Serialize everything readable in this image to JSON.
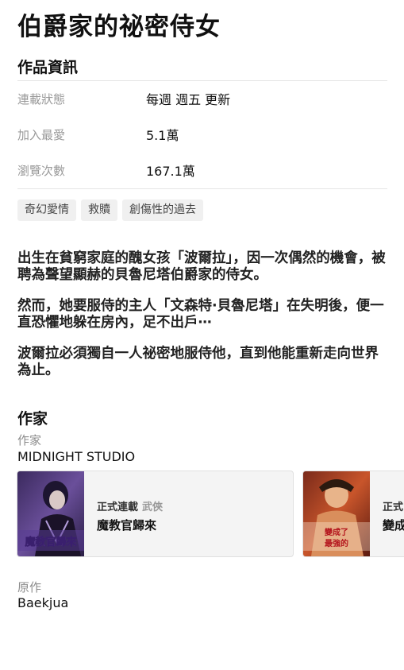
{
  "title": "伯爵家的祕密侍女",
  "info": {
    "section_title": "作品資訊",
    "rows": [
      {
        "label": "連載狀態",
        "value": "每週 週五 更新"
      },
      {
        "label": "加入最愛",
        "value": "5.1萬"
      },
      {
        "label": "瀏覽次數",
        "value": "167.1萬"
      }
    ],
    "tags": [
      "奇幻愛情",
      "救贖",
      "創傷性的過去"
    ]
  },
  "description": [
    "出生在貧窮家庭的醜女孩「波爾拉」，因一次偶然的機會，被聘為聲望顯赫的貝魯尼塔伯爵家的侍女。",
    "然而，她要服侍的主人「文森特·貝魯尼塔」在失明後，便一直恐懼地躲在房內，足不出戶⋯",
    "波爾拉必須獨自一人祕密地服侍他，直到他能重新走向世界為止。"
  ],
  "author_section": {
    "title": "作家",
    "author_label": "作家",
    "author_name": "MIDNIGHT STUDIO",
    "cards": [
      {
        "status": "正式連載",
        "genre": "武俠",
        "name": "魔教官歸來",
        "thumb_text": "魔教官歸來"
      },
      {
        "status": "正式",
        "genre": "",
        "name": "變成",
        "thumb_text": "變成了最強的"
      }
    ],
    "original_label": "原作",
    "original_name": "Baekjua"
  }
}
